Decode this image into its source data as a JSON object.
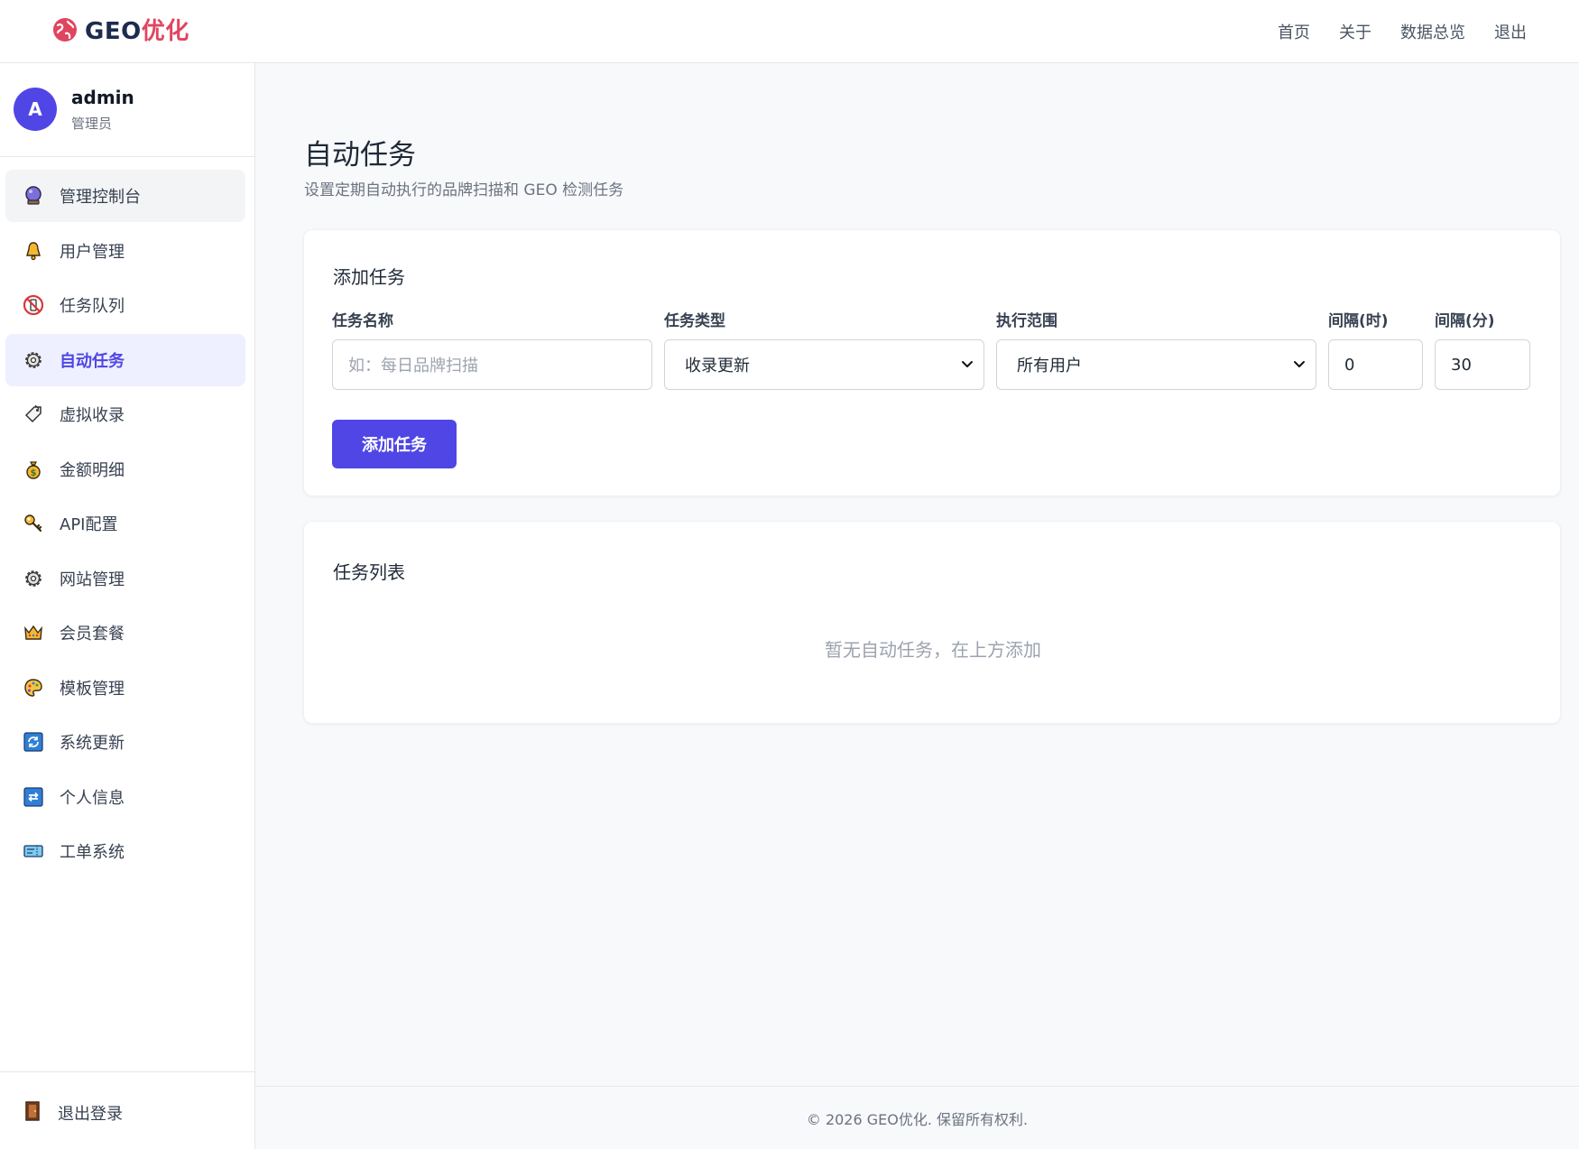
{
  "brand": {
    "prefix": "GEO",
    "suffix": "优化",
    "accent_color": "#e0455f"
  },
  "topnav": {
    "items": [
      "首页",
      "关于",
      "数据总览",
      "退出"
    ]
  },
  "user": {
    "initial": "A",
    "name": "admin",
    "role": "管理员"
  },
  "sidebar": {
    "items": [
      {
        "label": "管理控制台",
        "icon": "crystal-ball-icon",
        "state": "hover"
      },
      {
        "label": "用户管理",
        "icon": "bell-icon"
      },
      {
        "label": "任务队列",
        "icon": "no-phone-icon"
      },
      {
        "label": "自动任务",
        "icon": "gear-icon",
        "state": "active"
      },
      {
        "label": "虚拟收录",
        "icon": "tag-icon"
      },
      {
        "label": "金额明细",
        "icon": "money-bag-icon"
      },
      {
        "label": "API配置",
        "icon": "key-icon"
      },
      {
        "label": "网站管理",
        "icon": "gear-icon"
      },
      {
        "label": "会员套餐",
        "icon": "crown-icon"
      },
      {
        "label": "模板管理",
        "icon": "palette-icon"
      },
      {
        "label": "系统更新",
        "icon": "refresh-icon"
      },
      {
        "label": "个人信息",
        "icon": "repeat-icon"
      },
      {
        "label": "工单系统",
        "icon": "ticket-icon"
      }
    ],
    "logout": {
      "label": "退出登录",
      "icon": "door-icon"
    }
  },
  "page": {
    "title": "自动任务",
    "subtitle": "设置定期自动执行的品牌扫描和 GEO 检测任务"
  },
  "add_task": {
    "title": "添加任务",
    "name_label": "任务名称",
    "name_placeholder": "如：每日品牌扫描",
    "type_label": "任务类型",
    "type_value": "收录更新",
    "scope_label": "执行范围",
    "scope_value": "所有用户",
    "hours_label": "间隔(时)",
    "hours_value": "0",
    "minutes_label": "间隔(分)",
    "minutes_value": "30",
    "submit_label": "添加任务",
    "button_color": "#4f46e5"
  },
  "task_list": {
    "title": "任务列表",
    "empty_message": "暂无自动任务，在上方添加"
  },
  "footer": {
    "text": "© 2026 GEO优化. 保留所有权利."
  }
}
